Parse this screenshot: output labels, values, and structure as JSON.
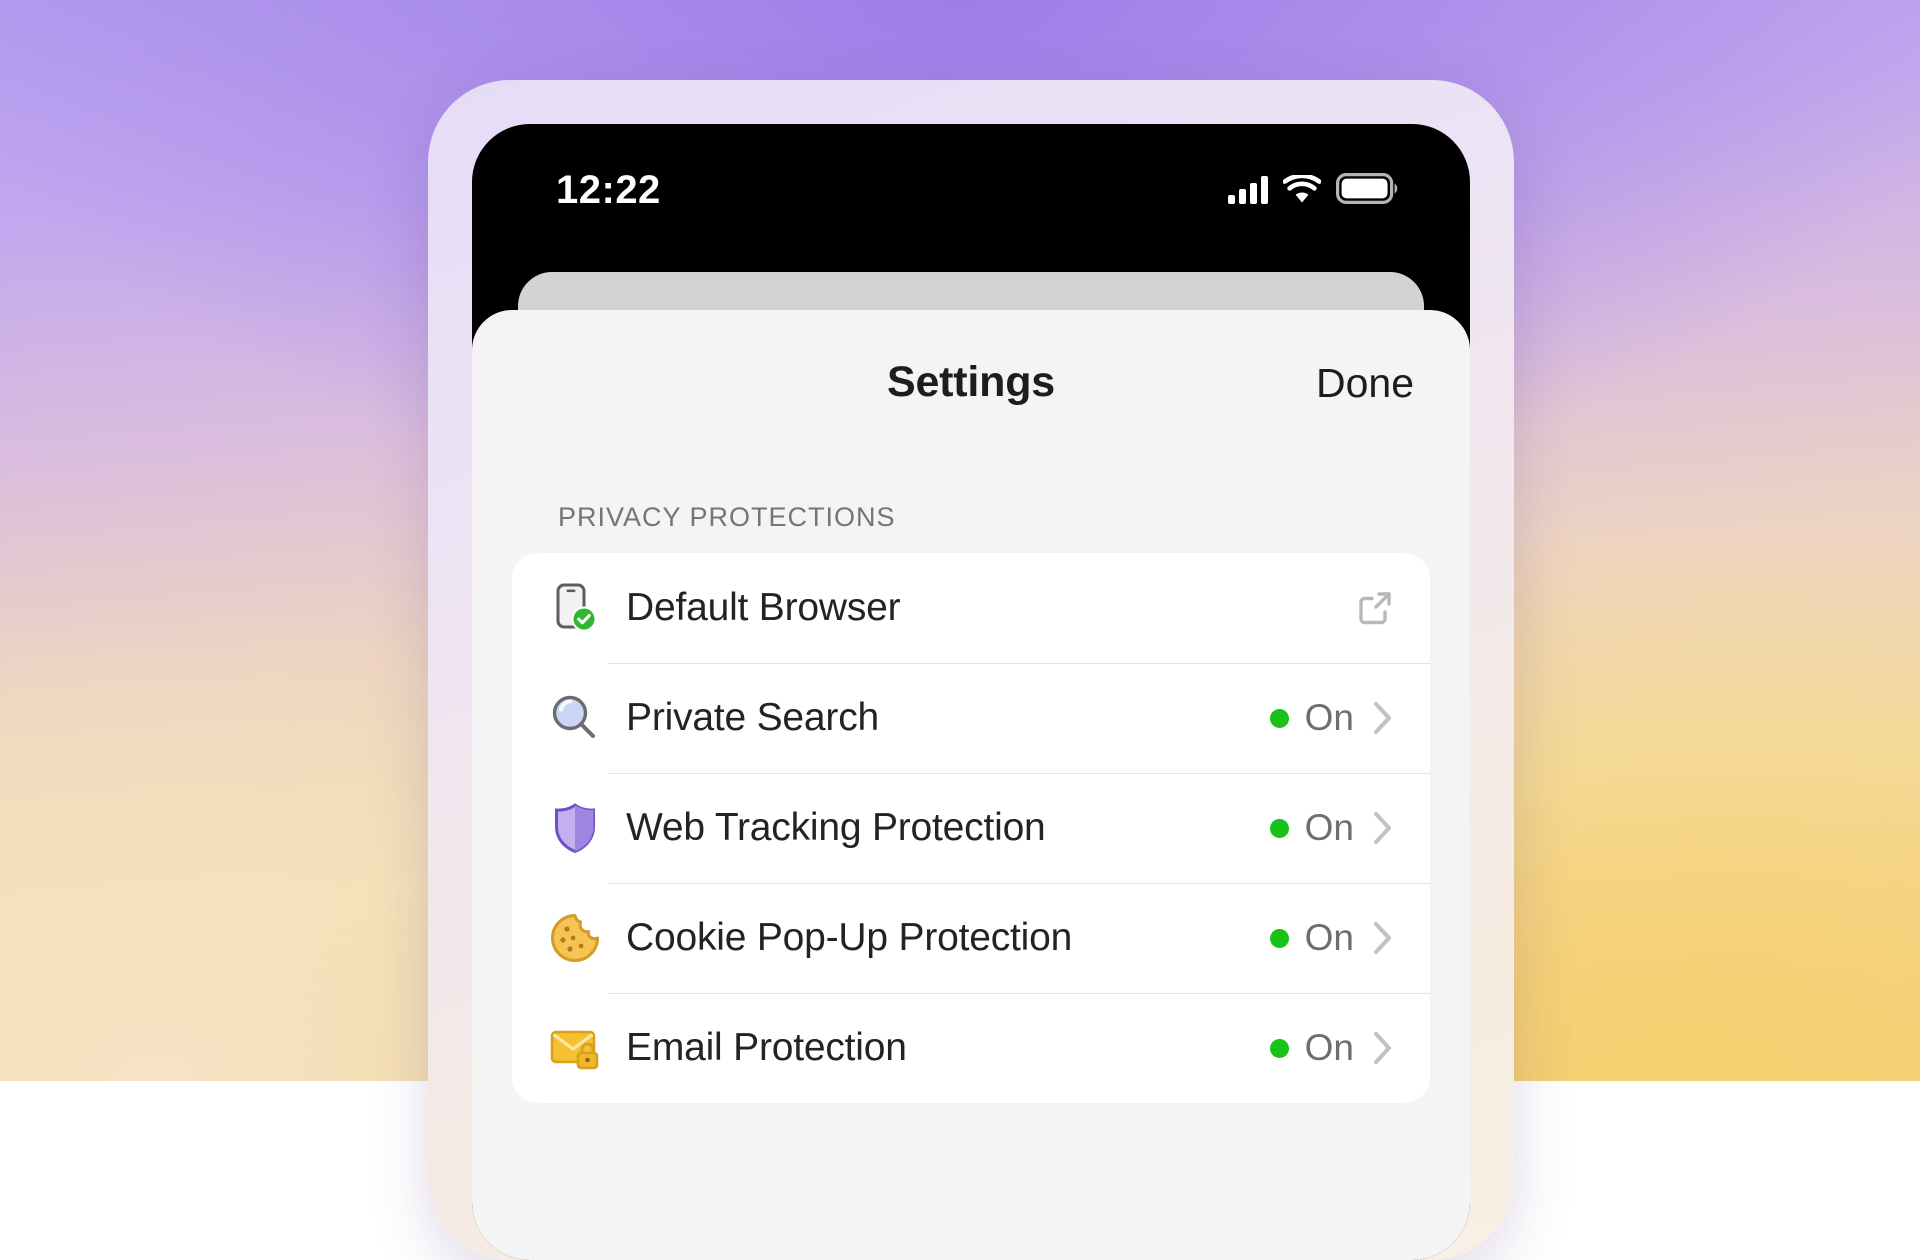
{
  "theme": {
    "accent_green": "#18c218",
    "bezel": "#ece3f5",
    "sheet_bg": "#f4f4f4",
    "card_bg": "#ffffff",
    "label_color": "#222325",
    "muted_color": "#6d6e72",
    "divider": "#e4e4e6"
  },
  "status_bar": {
    "time": "12:22",
    "cellular_icon": "cellular-signal-icon",
    "wifi_icon": "wifi-icon",
    "battery_icon": "battery-full-icon"
  },
  "sheet": {
    "title": "Settings",
    "done_label": "Done"
  },
  "sections": [
    {
      "header": "PRIVACY PROTECTIONS",
      "rows": [
        {
          "label": "Default Browser",
          "icon": "phone-with-check-icon",
          "accessory": "external-link",
          "status": null
        },
        {
          "label": "Private Search",
          "icon": "magnifying-glass-icon",
          "accessory": "chevron",
          "status": "On"
        },
        {
          "label": "Web Tracking Protection",
          "icon": "shield-icon",
          "accessory": "chevron",
          "status": "On"
        },
        {
          "label": "Cookie Pop-Up Protection",
          "icon": "cookie-icon",
          "accessory": "chevron",
          "status": "On"
        },
        {
          "label": "Email Protection",
          "icon": "envelope-lock-icon",
          "accessory": "chevron",
          "status": "On"
        }
      ]
    }
  ]
}
